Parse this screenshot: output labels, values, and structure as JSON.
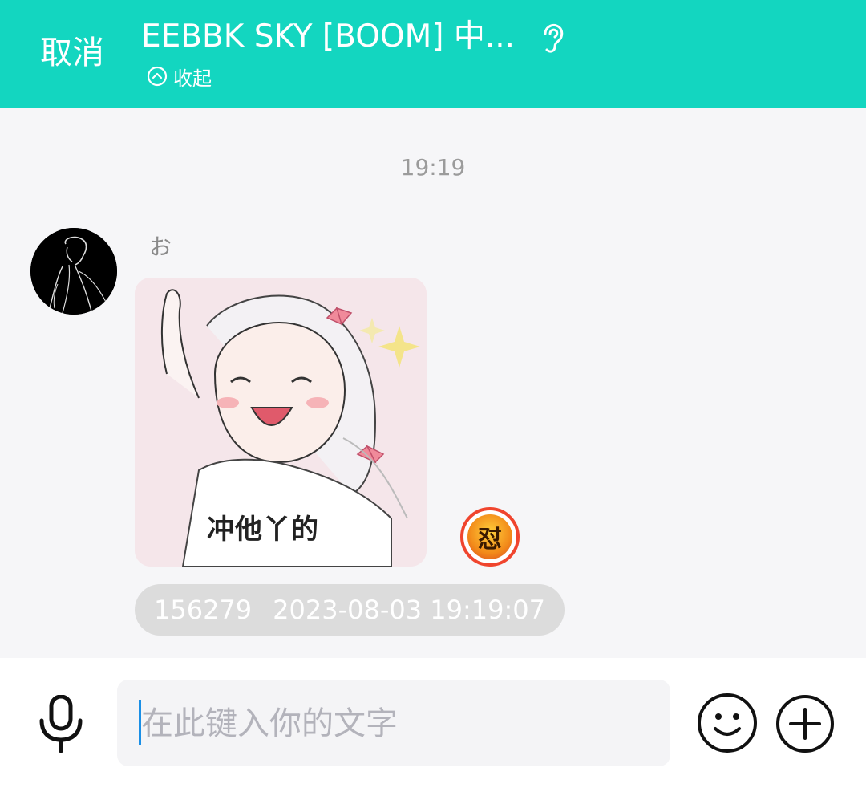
{
  "header": {
    "cancel_label": "取消",
    "title": "EEBBK SKY [BOOM] 中...",
    "collapse_label": "收起",
    "ear_icon": "ear-icon",
    "collapse_icon": "chevron-up-circle-icon",
    "background_color": "#13d6c0"
  },
  "chat": {
    "time_divider": "19:19",
    "messages": [
      {
        "sender_name": "お",
        "avatar_icon": "avatar-anime-line-art",
        "sticker_caption": "冲他丫的",
        "badge_glyph": "怼",
        "meta_id": "156279",
        "meta_timestamp": "2023-08-03 19:19:07"
      }
    ]
  },
  "composer": {
    "placeholder": "在此键入你的文字",
    "mic_icon": "microphone-icon",
    "emoji_icon": "smile-icon",
    "add_icon": "plus-circle-icon",
    "caret_color": "#1a8fe6"
  }
}
